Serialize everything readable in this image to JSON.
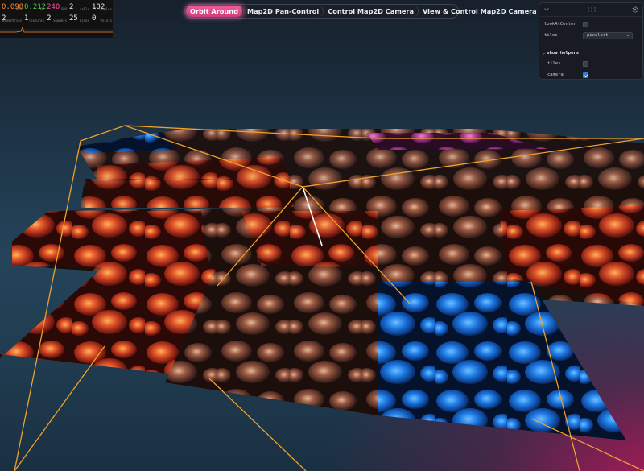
{
  "stats": {
    "cells": [
      {
        "value": "0.098",
        "label": "FPS",
        "color_class": "sc1"
      },
      {
        "value": "0.212",
        "label": "CPU",
        "color_class": "sc2"
      },
      {
        "value": "240",
        "label": "GPU",
        "color_class": "sc3"
      },
      {
        "value": "2",
        "label": "calls",
        "color_class": "sc4"
      },
      {
        "value": "102",
        "label": "Triangles",
        "color_class": "sc4"
      }
    ],
    "cells2": [
      {
        "value": "2",
        "label": "Geometries"
      },
      {
        "value": "1",
        "label": "Textures"
      },
      {
        "value": "2",
        "label": "Shaders"
      },
      {
        "value": "25",
        "label": "Lines"
      },
      {
        "value": "0",
        "label": "Points"
      }
    ]
  },
  "tabs": [
    {
      "label": "Orbit Around",
      "active": true
    },
    {
      "label": "Map2D Pan-Control",
      "active": false
    },
    {
      "label": "Control Map2D Camera",
      "active": false
    },
    {
      "label": "View & Control Map2D Camera",
      "active": false
    }
  ],
  "gui": {
    "controls": {
      "lookAtCenter": {
        "label": "lookAtCenter",
        "checked": false
      },
      "tiles": {
        "label": "tiles",
        "value": "pixelart"
      }
    },
    "folder": {
      "title": "show helpers",
      "tiles": {
        "label": "tiles",
        "checked": false
      },
      "camera": {
        "label": "camera",
        "checked": true
      }
    }
  },
  "colors": {
    "accent_tab": "#e24b8c",
    "helper_line": "#f0a12a",
    "checkbox_on": "#2f7ce0",
    "tile_red": "#b8321c",
    "tile_brown": "#7a4a36",
    "tile_blue": "#1f6fe0",
    "tile_pink": "#c83aa0"
  }
}
